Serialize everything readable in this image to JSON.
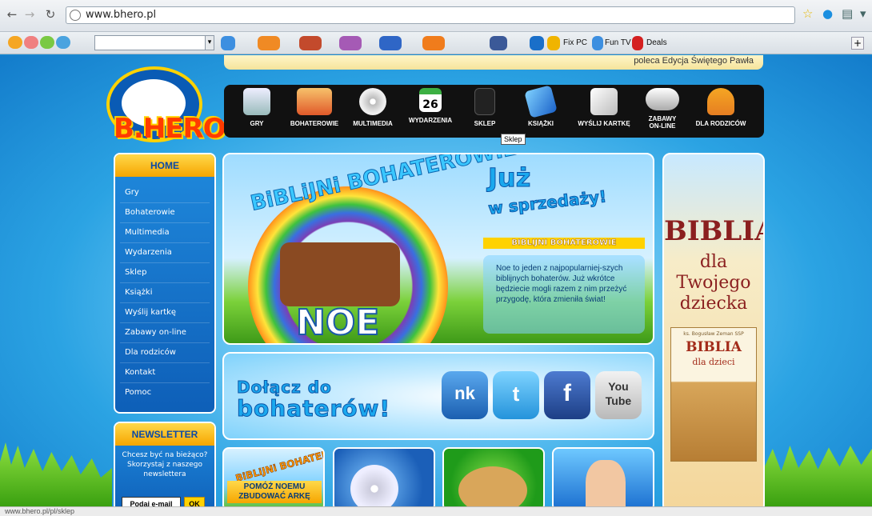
{
  "browser": {
    "url": "www.bhero.pl",
    "status_url": "www.bhero.pl/pl/sklep"
  },
  "toolbar": {
    "links": [
      "Fix PC",
      "Fun TV",
      "Deals"
    ]
  },
  "page": {
    "top_banner_text": "poleca Edycja Świętego Pawła",
    "logo_text": "B.HERO",
    "nav": [
      {
        "label": "GRY",
        "icon": "disc-box-icon"
      },
      {
        "label": "BOHATEROWIE",
        "icon": "heroes-icon"
      },
      {
        "label": "MULTIMEDIA",
        "icon": "cd-icon"
      },
      {
        "label": "WYDARZENIA",
        "icon": "calendar-icon",
        "badge": "26"
      },
      {
        "label": "SKLEP",
        "icon": "shopping-bag-icon"
      },
      {
        "label": "KSIĄŻKI",
        "icon": "book-icon"
      },
      {
        "label": "WYŚLIJ KARTKĘ",
        "icon": "envelope-icon"
      },
      {
        "label": "ZABAWY ON-LINE",
        "icon": "gamepad-icon"
      },
      {
        "label": "DLA RODZICÓW",
        "icon": "parents-icon"
      }
    ],
    "tooltip": "Sklep",
    "sidebar": {
      "title": "HOME",
      "items": [
        "Gry",
        "Bohaterowie",
        "Multimedia",
        "Wydarzenia",
        "Sklep",
        "Książki",
        "Wyślij kartkę",
        "Zabawy on-line",
        "Dla rodziców",
        "Kontakt",
        "Pomoc"
      ]
    },
    "newsletter": {
      "title": "NEWSLETTER",
      "text": "Chcesz być na bieżąco? Skorzystaj z naszego newslettera",
      "input_label": "Podaj e-mail",
      "ok_label": "OK"
    },
    "hero": {
      "arc_title": "BiBLiJNi BOHATEROWIE",
      "name": "NOE",
      "headline1": "Już",
      "headline2": "w sprzedaży!",
      "series_label": "BIBLIJNI BOHATEROWIE",
      "description": "Noe to jeden z najpopularniej-szych biblijnych bohaterów. Już wkrótce będziecie mogli razem z nim przeżyć przygodę, która zmieniła świat!"
    },
    "join": {
      "line1": "Dołącz do",
      "line2": "bohaterów!",
      "social": [
        {
          "label": "nk",
          "color": "#2a7fd0"
        },
        {
          "label": "t",
          "color": "#35a9e8"
        },
        {
          "label": "f",
          "color": "#2b57a8"
        },
        {
          "label": "You Tube",
          "color": "#c9c9c9"
        }
      ]
    },
    "tiles": {
      "tile1_arc": "BiBLiJNi BOHATEROWIE",
      "tile1_caption": "POMÓŻ NOEMU ZBUDOWAĆ ARKĘ"
    },
    "side_ad": {
      "title": "BIBLIA",
      "subtitle": "dla Twojego dziecka",
      "book_author": "ks. Bogusław Zeman SSP",
      "book_title": "BIBLIA",
      "book_subtitle": "dla dzieci"
    }
  }
}
